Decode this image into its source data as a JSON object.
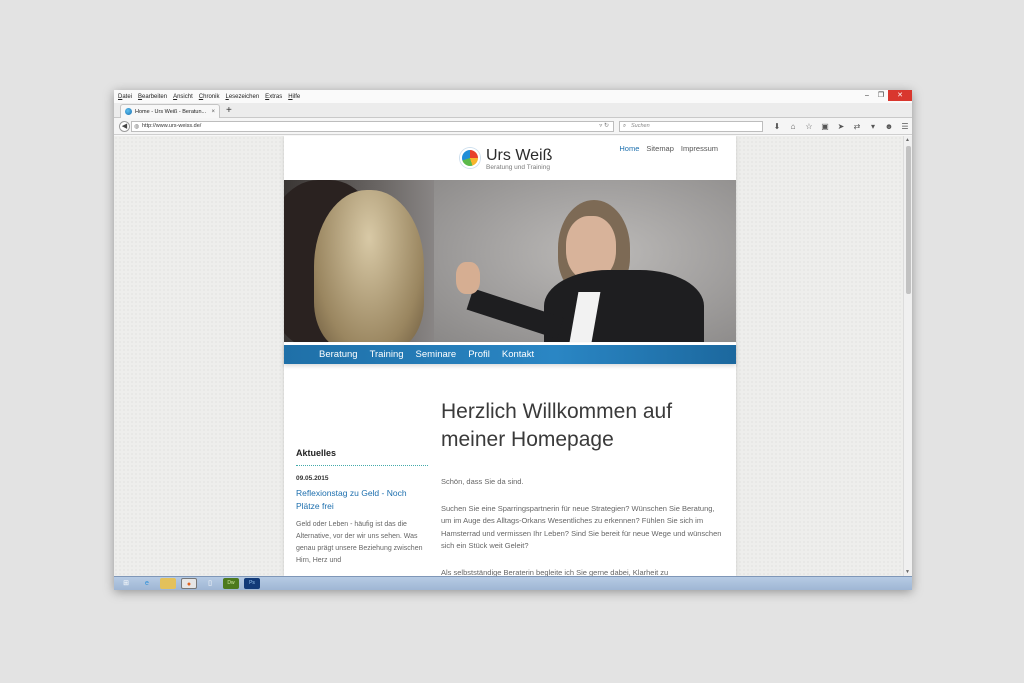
{
  "browser": {
    "menu": [
      "Datei",
      "Bearbeiten",
      "Ansicht",
      "Chronik",
      "Lesezeichen",
      "Extras",
      "Hilfe"
    ],
    "window_controls": [
      "–",
      "❐",
      "✕"
    ],
    "tab": {
      "title": "Home - Urs Weiß - Beratun...",
      "close": "×"
    },
    "new_tab": "+",
    "url": "http://www.urs-weiss.de/",
    "search_placeholder": "Suchen"
  },
  "site": {
    "logo": {
      "name": "Urs Weiß",
      "tagline": "Beratung und Training"
    },
    "top_nav": [
      "Home",
      "Sitemap",
      "Impressum"
    ],
    "main_nav": [
      "Beratung",
      "Training",
      "Seminare",
      "Profil",
      "Kontakt"
    ],
    "sidebar": {
      "heading": "Aktuelles",
      "date": "09.05.2015",
      "link": "Reflexionstag zu Geld - Noch Plätze frei",
      "text": "Geld oder Leben - häufig ist das die Alternative, vor der wir uns sehen. Was genau prägt unsere Beziehung zwischen Hirn, Herz und"
    },
    "content": {
      "title": "Herzlich Willkommen auf meiner Homepage",
      "p1": "Schön, dass Sie da sind.",
      "p2": "Suchen Sie eine Sparringspartnerin für neue Strategien? Wünschen Sie Beratung, um im Auge des Alltags-Orkans Wesentliches zu erkennen? Fühlen Sie sich im Hamsterrad und vermissen Ihr Leben? Sind Sie bereit für neue Wege und wünschen sich ein Stück weit Geleit?",
      "p3": "Als selbstständige Beraterin begleite ich Sie gerne dabei, Klarheit zu"
    }
  }
}
